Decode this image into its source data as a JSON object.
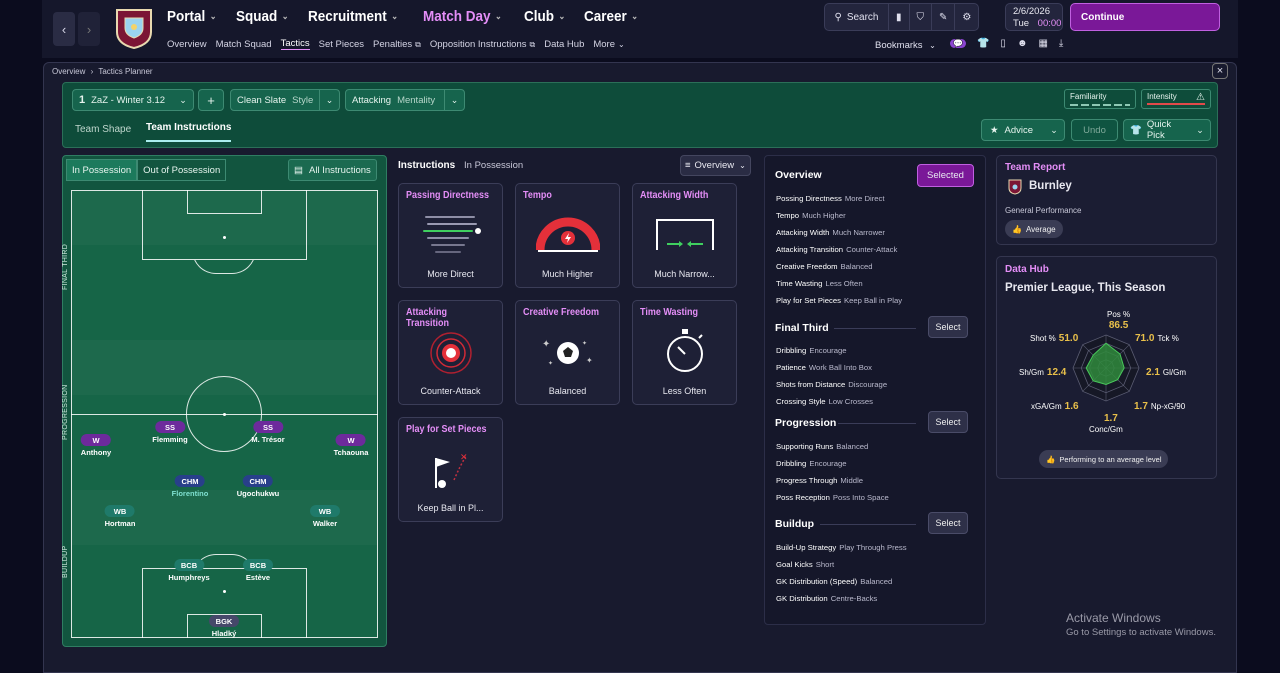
{
  "topbar": {
    "main_nav": [
      {
        "label": "Portal",
        "active": false
      },
      {
        "label": "Squad",
        "active": false
      },
      {
        "label": "Recruitment",
        "active": false
      },
      {
        "label": "Match Day",
        "active": true
      },
      {
        "label": "Club",
        "active": false
      },
      {
        "label": "Career",
        "active": false
      }
    ],
    "sub_nav": [
      "Overview",
      "Match Squad",
      "Tactics",
      "Set Pieces",
      "Penalties",
      "Opposition Instructions",
      "Data Hub",
      "More"
    ],
    "sub_nav_active": "Tactics",
    "search_label": "Search",
    "date": "2/6/2026",
    "day": "Tue",
    "time": "00:00",
    "continue_label": "Continue",
    "bookmarks_label": "Bookmarks"
  },
  "breadcrumb": {
    "root": "Overview",
    "current": "Tactics Planner"
  },
  "tactic_bar": {
    "slot": "1",
    "tactic_name": "ZaZ - Winter 3.12",
    "add_label": "+",
    "style_value": "Clean Slate",
    "style_label": "Style",
    "mentality_value": "Attacking",
    "mentality_label": "Mentality",
    "familiarity_label": "Familiarity",
    "intensity_label": "Intensity"
  },
  "tabs": {
    "shape": "Team Shape",
    "instructions": "Team Instructions"
  },
  "actions": {
    "advice": "Advice",
    "undo": "Undo",
    "quick_pick": "Quick Pick"
  },
  "possession": {
    "in": "In Possession",
    "out": "Out of Possession",
    "all": "All Instructions"
  },
  "zones": {
    "final_third": "FINAL THIRD",
    "progression": "PROGRESSION",
    "buildup": "BUILDUP"
  },
  "players": [
    {
      "role": "W",
      "name": "Anthony",
      "cls": "w"
    },
    {
      "role": "SS",
      "name": "Flemming",
      "cls": "ss"
    },
    {
      "role": "SS",
      "name": "M. Trésor",
      "cls": "ss"
    },
    {
      "role": "W",
      "name": "Tchaouna",
      "cls": "w"
    },
    {
      "role": "CHM",
      "name": "Florentino",
      "cls": "chm"
    },
    {
      "role": "CHM",
      "name": "Ugochukwu",
      "cls": "chm"
    },
    {
      "role": "WB",
      "name": "Hortman",
      "cls": "wb"
    },
    {
      "role": "WB",
      "name": "Walker",
      "cls": "wb"
    },
    {
      "role": "BCB",
      "name": "Humphreys",
      "cls": "bcb"
    },
    {
      "role": "BCB",
      "name": "Estève",
      "cls": "bcb"
    },
    {
      "role": "BGK",
      "name": "Hladký",
      "cls": "bgk"
    }
  ],
  "instructions_header": {
    "title": "Instructions",
    "sub": "In Possession",
    "view": "Overview"
  },
  "cards": [
    {
      "title": "Passing Directness",
      "value": "More Direct"
    },
    {
      "title": "Tempo",
      "value": "Much Higher"
    },
    {
      "title": "Attacking Width",
      "value": "Much Narrow..."
    },
    {
      "title": "Attacking Transition",
      "value": "Counter-Attack"
    },
    {
      "title": "Creative Freedom",
      "value": "Balanced"
    },
    {
      "title": "Time Wasting",
      "value": "Less Often"
    },
    {
      "title": "Play for Set Pieces",
      "value": "Keep Ball in Pl..."
    }
  ],
  "overview": {
    "title": "Overview",
    "selected_label": "Selected",
    "select_label": "Select",
    "overview_rows": [
      [
        "Possing Directness",
        "More Direct"
      ],
      [
        "Tempo",
        "Much Higher"
      ],
      [
        "Attacking Width",
        "Much Narrower"
      ],
      [
        "Attacking Transition",
        "Counter-Attack"
      ],
      [
        "Creative Freedom",
        "Balanced"
      ],
      [
        "Time Wasting",
        "Less Often"
      ],
      [
        "Play for Set Pieces",
        "Keep Ball in Play"
      ]
    ],
    "final_third_title": "Final Third",
    "final_third_rows": [
      [
        "Dribbling",
        "Encourage"
      ],
      [
        "Patience",
        "Work Ball Into Box"
      ],
      [
        "Shots from Distance",
        "Discourage"
      ],
      [
        "Crossing Style",
        "Low Crosses"
      ]
    ],
    "progression_title": "Progression",
    "progression_rows": [
      [
        "Supporting Runs",
        "Balanced"
      ],
      [
        "Dribbling",
        "Encourage"
      ],
      [
        "Progress Through",
        "Middle"
      ],
      [
        "Poss Reception",
        "Poss Into Space"
      ]
    ],
    "buildup_title": "Buildup",
    "buildup_rows": [
      [
        "Build-Up Strategy",
        "Play Through Press"
      ],
      [
        "Goal Kicks",
        "Short"
      ],
      [
        "GK Distribution (Speed)",
        "Balanced"
      ],
      [
        "GK Distribution",
        "Centre-Backs"
      ]
    ]
  },
  "team_report": {
    "title": "Team Report",
    "team": "Burnley",
    "label": "General Performance",
    "rating": "Average"
  },
  "data_hub": {
    "title": "Data Hub",
    "subtitle": "Premier League, This Season",
    "stats": [
      {
        "label": "Pos %",
        "value": "86.5"
      },
      {
        "label": "Tck %",
        "value": "71.0"
      },
      {
        "label": "Gl/Gm",
        "value": "2.1"
      },
      {
        "label": "Np-xG/90",
        "value": "1.7"
      },
      {
        "label": "Conc/Gm",
        "value": "1.7"
      },
      {
        "label": "xGA/Gm",
        "value": "1.6"
      },
      {
        "label": "Sh/Gm",
        "value": "12.4"
      },
      {
        "label": "Shot %",
        "value": "51.0"
      }
    ],
    "radar_levels": [
      0.75,
      0.6,
      0.55,
      0.5,
      0.5,
      0.55,
      0.6,
      0.55
    ],
    "summary": "Performing to an average level"
  },
  "watermark": {
    "title": "Activate Windows",
    "sub": "Go to Settings to activate Windows."
  },
  "colors": {
    "accent": "#e48ef7",
    "pitch": "#166547",
    "continue": "#7a1898"
  }
}
